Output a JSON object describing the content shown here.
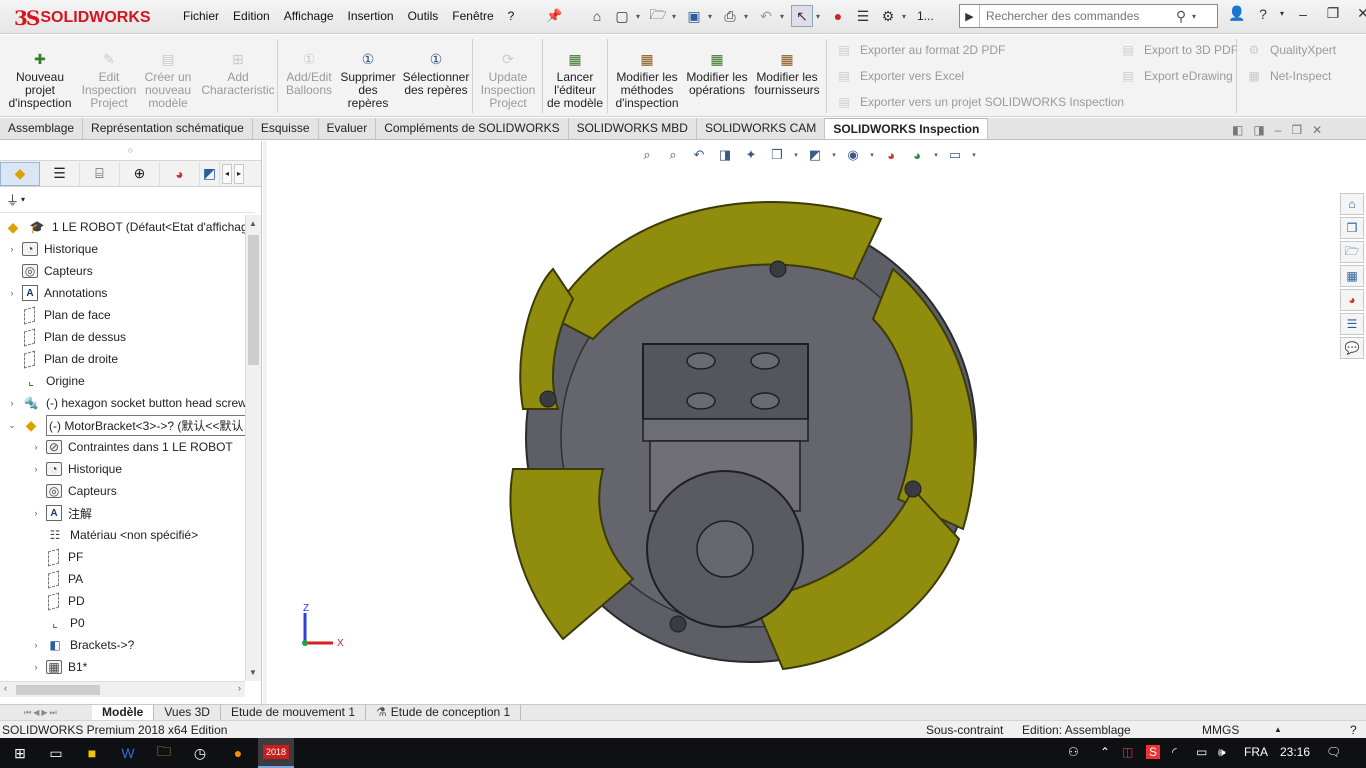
{
  "app": {
    "logo_prefix": "3S",
    "logo_name": "SOLIDWORKS",
    "menus": [
      "Fichier",
      "Edition",
      "Affichage",
      "Insertion",
      "Outils",
      "Fenêtre",
      "?"
    ],
    "filename_short": "1...",
    "search_placeholder": "Rechercher des commandes",
    "toolbar_icons": [
      "home-icon",
      "new-icon",
      "open-icon",
      "save-icon",
      "print-icon",
      "undo-icon",
      "select-icon",
      "rebuild-icon",
      "options-icon"
    ]
  },
  "command_manager": {
    "buttons": [
      {
        "label": "Nouveau projet d'inspection",
        "enabled": true
      },
      {
        "label": "Edit Inspection Project",
        "enabled": false
      },
      {
        "label": "Créer un nouveau modèle",
        "enabled": false
      },
      {
        "label": "Add Characteristic",
        "enabled": false
      },
      {
        "label": "Add/Edit Balloons",
        "enabled": false
      },
      {
        "label": "Supprimer des repères",
        "enabled": true
      },
      {
        "label": "Sélectionner des repères",
        "enabled": true
      },
      {
        "label": "Update Inspection Project",
        "enabled": false
      },
      {
        "label": "Lancer l'éditeur de modèle",
        "enabled": true
      },
      {
        "label": "Modifier les méthodes d'inspection",
        "enabled": true
      },
      {
        "label": "Modifier les opérations",
        "enabled": true
      },
      {
        "label": "Modifier les fournisseurs",
        "enabled": true
      }
    ],
    "export_items": [
      "Exporter au format 2D PDF",
      "Exporter vers Excel",
      "Exporter vers un projet SOLIDWORKS Inspection",
      "Export to 3D PDF",
      "Export eDrawing",
      "QualityXpert",
      "Net-Inspect"
    ]
  },
  "tabs": [
    "Assemblage",
    "Représentation schématique",
    "Esquisse",
    "Evaluer",
    "Compléments de SOLIDWORKS",
    "SOLIDWORKS MBD",
    "SOLIDWORKS CAM",
    "SOLIDWORKS Inspection"
  ],
  "active_tab": "SOLIDWORKS Inspection",
  "tree": {
    "items": [
      {
        "label": "1 LE ROBOT  (Défaut<Etat d'affichage",
        "icon": "assembly-icon",
        "expander": ""
      },
      {
        "label": "Historique",
        "icon": "history-icon",
        "expander": "›"
      },
      {
        "label": "Capteurs",
        "icon": "sensor-icon",
        "expander": ""
      },
      {
        "label": "Annotations",
        "icon": "annotation-icon",
        "expander": "›"
      },
      {
        "label": "Plan de face",
        "icon": "plane-icon",
        "expander": ""
      },
      {
        "label": "Plan de dessus",
        "icon": "plane-icon",
        "expander": ""
      },
      {
        "label": "Plan de droite",
        "icon": "plane-icon",
        "expander": ""
      },
      {
        "label": "Origine",
        "icon": "origin-icon",
        "expander": ""
      },
      {
        "label": "(-) hexagon socket button head screw",
        "icon": "screw-icon",
        "expander": "›"
      },
      {
        "label": "(-) MotorBracket<3>->? (默认<<默认",
        "icon": "assembly-icon",
        "expander": "⌄"
      },
      {
        "label": "Contraintes dans 1 LE ROBOT",
        "icon": "mates-icon",
        "expander": "›"
      },
      {
        "label": "Historique",
        "icon": "history-icon",
        "expander": "›"
      },
      {
        "label": "Capteurs",
        "icon": "sensor-icon",
        "expander": ""
      },
      {
        "label": "注解",
        "icon": "annotation-icon",
        "expander": "›"
      },
      {
        "label": "Matériau <non spécifié>",
        "icon": "material-icon",
        "expander": ""
      },
      {
        "label": "PF",
        "icon": "plane-icon",
        "expander": ""
      },
      {
        "label": "PA",
        "icon": "plane-icon",
        "expander": ""
      },
      {
        "label": "PD",
        "icon": "plane-icon",
        "expander": ""
      },
      {
        "label": "P0",
        "icon": "origin-icon",
        "expander": ""
      },
      {
        "label": "Brackets->?",
        "icon": "feature-icon",
        "expander": "›"
      },
      {
        "label": "B1*",
        "icon": "feature-icon",
        "expander": "›"
      }
    ]
  },
  "triad": {
    "z": "Z",
    "x": "X"
  },
  "bottom_tabs": [
    "Modèle",
    "Vues 3D",
    "Etude de mouvement 1",
    "Etude de conception 1"
  ],
  "active_bottom_tab": "Modèle",
  "status": {
    "product": "SOLIDWORKS Premium 2018 x64 Edition",
    "constraint": "Sous-contraint",
    "mode": "Edition: Assemblage",
    "units": "MMGS"
  },
  "taskbar": {
    "lang": "FRA",
    "time": "23:16",
    "app_badge": "2018"
  },
  "colors": {
    "wheel_roller": "#8f8c0e",
    "hub": "#5e5f66",
    "motor": "#6f6f75",
    "brand": "#d6141e"
  }
}
